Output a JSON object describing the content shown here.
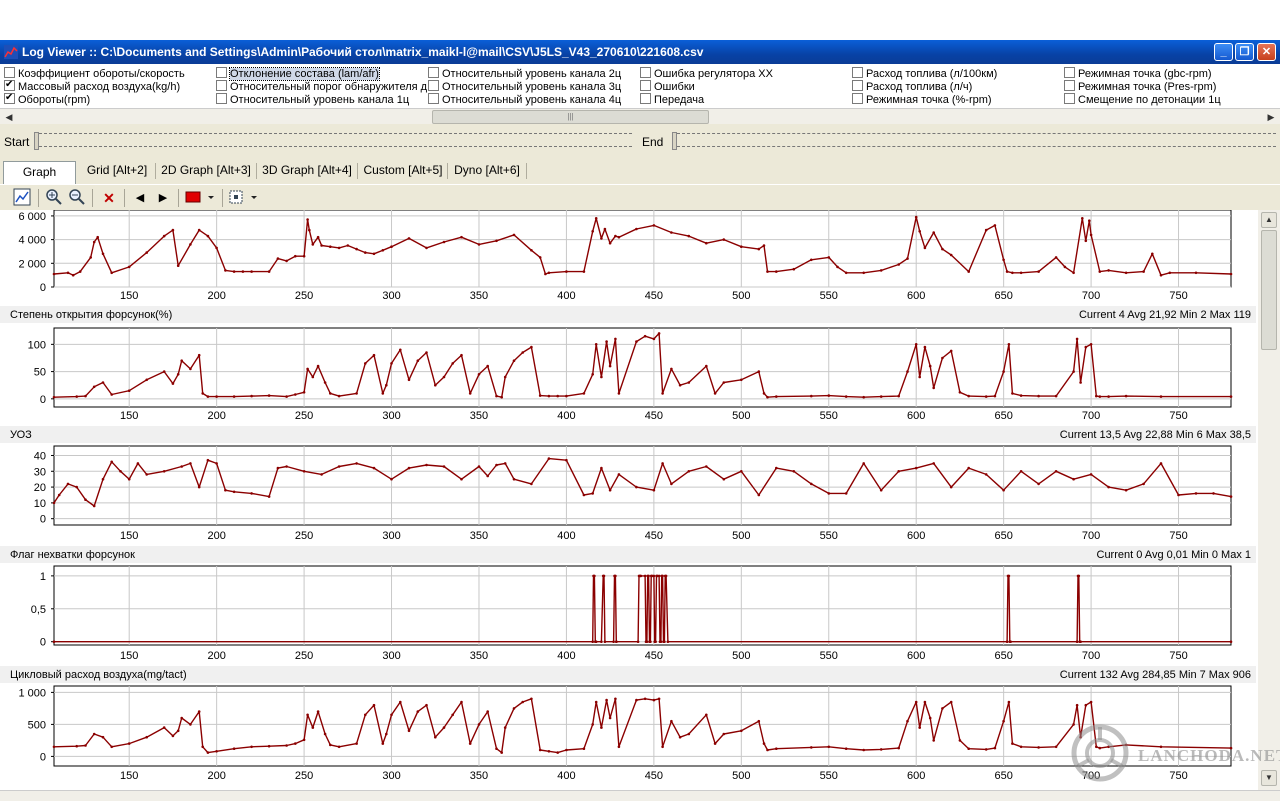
{
  "window": {
    "title": "Log Viewer :: C:\\Documents and Settings\\Admin\\Рабочий стол\\matrix_maikl-l@mail\\CSV\\J5LS_V43_270610\\221608.csv",
    "minimize": "_",
    "maximize": "❐",
    "close": "✕"
  },
  "params": [
    {
      "label": "Коэффициент обороты/скорость",
      "checked": false,
      "selected": false
    },
    {
      "label": "Массовый расход воздуха(kg/h)",
      "checked": true,
      "selected": false
    },
    {
      "label": "Обороты(rpm)",
      "checked": true,
      "selected": false
    },
    {
      "label": "Отклонение состава (lam/afr)",
      "checked": false,
      "selected": true
    },
    {
      "label": "Относительный порог обнаружителя д",
      "checked": false,
      "selected": false
    },
    {
      "label": "Относительный уровень канала 1ц",
      "checked": false,
      "selected": false
    },
    {
      "label": "Относительный уровень канала 2ц",
      "checked": false,
      "selected": false
    },
    {
      "label": "Относительный уровень канала 3ц",
      "checked": false,
      "selected": false
    },
    {
      "label": "Относительный уровень канала 4ц",
      "checked": false,
      "selected": false
    },
    {
      "label": "Ошибка регулятора ХХ",
      "checked": false,
      "selected": false
    },
    {
      "label": "Ошибки",
      "checked": false,
      "selected": false
    },
    {
      "label": "Передача",
      "checked": false,
      "selected": false
    },
    {
      "label": "Расход топлива (л/100км)",
      "checked": false,
      "selected": false
    },
    {
      "label": "Расход топлива (л/ч)",
      "checked": false,
      "selected": false
    },
    {
      "label": "Режимная точка (%-rpm)",
      "checked": false,
      "selected": false
    },
    {
      "label": "Режимная точка (gbc-rpm)",
      "checked": false,
      "selected": false
    },
    {
      "label": "Режимная точка (Pres-rpm)",
      "checked": false,
      "selected": false
    },
    {
      "label": "Смещение по детонации 1ц",
      "checked": false,
      "selected": false
    }
  ],
  "range": {
    "start_label": "Start",
    "end_label": "End"
  },
  "tabs": [
    {
      "label": "Graph [Alt+1]",
      "active": true
    },
    {
      "label": "Grid [Alt+2]",
      "active": false
    },
    {
      "label": "2D Graph [Alt+3]",
      "active": false
    },
    {
      "label": "3D Graph [Alt+4]",
      "active": false
    },
    {
      "label": "Custom [Alt+5]",
      "active": false
    },
    {
      "label": "Dyno [Alt+6]",
      "active": false
    }
  ],
  "toolbar": {
    "icons": [
      "chart-icon",
      "zoom-in-icon",
      "zoom-out-icon",
      "delete-icon",
      "prev-icon",
      "next-icon",
      "color-icon",
      "grid-select-icon"
    ]
  },
  "colors": {
    "series": "#8b0000",
    "grid": "#c8c8c8",
    "header_bg": "#f0f0f0"
  },
  "watermark": "LANCHODA.NET",
  "chart_data": [
    {
      "type": "line",
      "title": "",
      "stats": "",
      "yticks": [
        "6 000",
        "4 000",
        "2 000",
        "0"
      ],
      "ytick_values": [
        6000,
        4000,
        2000,
        0
      ],
      "ylim": [
        0,
        6500
      ],
      "xlim": [
        107,
        780
      ],
      "xticks": [
        150,
        200,
        250,
        300,
        350,
        400,
        450,
        500,
        550,
        600,
        650,
        700,
        750
      ],
      "x": [
        107,
        115,
        118,
        122,
        128,
        130,
        132,
        135,
        140,
        150,
        160,
        170,
        175,
        178,
        185,
        190,
        195,
        200,
        205,
        210,
        215,
        220,
        230,
        235,
        240,
        245,
        250,
        252,
        253,
        255,
        258,
        260,
        265,
        270,
        275,
        280,
        285,
        290,
        295,
        300,
        310,
        320,
        330,
        340,
        350,
        360,
        370,
        380,
        385,
        388,
        390,
        400,
        410,
        415,
        417,
        420,
        422,
        425,
        428,
        430,
        440,
        450,
        460,
        470,
        480,
        490,
        500,
        510,
        513,
        515,
        520,
        530,
        540,
        550,
        555,
        560,
        570,
        580,
        590,
        595,
        600,
        602,
        605,
        610,
        615,
        620,
        630,
        640,
        645,
        650,
        652,
        655,
        660,
        670,
        680,
        685,
        690,
        695,
        697,
        699,
        700,
        705,
        710,
        720,
        730,
        735,
        740,
        745,
        760,
        780
      ],
      "y": [
        1100,
        1200,
        1000,
        1300,
        2500,
        3800,
        4200,
        2800,
        1200,
        1700,
        2900,
        4300,
        4800,
        1800,
        3600,
        4800,
        4300,
        3300,
        1400,
        1300,
        1300,
        1300,
        1300,
        2400,
        2200,
        2600,
        2600,
        5700,
        4800,
        3600,
        4200,
        3500,
        3400,
        3300,
        3500,
        3200,
        2900,
        2800,
        3100,
        3400,
        4100,
        3300,
        3800,
        4200,
        3600,
        3900,
        4400,
        3100,
        2500,
        1100,
        1200,
        1300,
        1300,
        4700,
        5800,
        4100,
        4900,
        3700,
        4300,
        4200,
        4900,
        5200,
        4600,
        4300,
        3700,
        4000,
        3400,
        3200,
        3500,
        1300,
        1300,
        1500,
        2300,
        2500,
        1700,
        1200,
        1200,
        1400,
        1900,
        2400,
        5900,
        4700,
        3300,
        4600,
        3200,
        2700,
        1300,
        4800,
        5200,
        2300,
        1300,
        1200,
        1200,
        1300,
        2500,
        1700,
        1200,
        5800,
        3900,
        5600,
        4400,
        1300,
        1400,
        1200,
        1300,
        2800,
        1000,
        1200,
        1200,
        1100
      ]
    },
    {
      "type": "line",
      "title": "Степень открытия форсунок(%)",
      "stats": "Current 4 Avg 21,92 Min 2 Max 119",
      "yticks": [
        "100",
        "50",
        "0"
      ],
      "ytick_values": [
        100,
        50,
        0
      ],
      "ylim": [
        -15,
        130
      ],
      "xlim": [
        107,
        780
      ],
      "xticks": [
        150,
        200,
        250,
        300,
        350,
        400,
        450,
        500,
        550,
        600,
        650,
        700,
        750
      ],
      "x": [
        107,
        120,
        125,
        130,
        135,
        140,
        150,
        160,
        170,
        175,
        178,
        180,
        185,
        190,
        192,
        195,
        200,
        210,
        220,
        230,
        240,
        245,
        250,
        252,
        255,
        258,
        262,
        265,
        270,
        280,
        285,
        290,
        295,
        297,
        300,
        305,
        310,
        315,
        320,
        325,
        330,
        335,
        340,
        345,
        350,
        355,
        360,
        363,
        365,
        370,
        375,
        380,
        385,
        390,
        395,
        400,
        410,
        415,
        417,
        420,
        423,
        425,
        428,
        430,
        440,
        445,
        450,
        453,
        455,
        460,
        465,
        470,
        480,
        485,
        490,
        500,
        510,
        513,
        515,
        520,
        540,
        550,
        560,
        570,
        580,
        590,
        595,
        600,
        602,
        605,
        608,
        610,
        615,
        620,
        625,
        630,
        640,
        645,
        650,
        653,
        655,
        660,
        670,
        680,
        690,
        692,
        694,
        697,
        700,
        703,
        705,
        710,
        720,
        740,
        780
      ],
      "y": [
        3,
        4,
        5,
        22,
        30,
        8,
        15,
        35,
        50,
        28,
        45,
        70,
        55,
        80,
        10,
        4,
        4,
        4,
        5,
        6,
        4,
        8,
        12,
        55,
        40,
        60,
        30,
        10,
        5,
        10,
        65,
        80,
        10,
        25,
        65,
        90,
        35,
        70,
        85,
        25,
        40,
        65,
        80,
        10,
        45,
        60,
        5,
        3,
        40,
        70,
        85,
        95,
        6,
        5,
        5,
        5,
        10,
        45,
        100,
        40,
        105,
        60,
        110,
        10,
        105,
        115,
        110,
        120,
        10,
        55,
        25,
        30,
        60,
        10,
        30,
        35,
        50,
        10,
        3,
        4,
        5,
        6,
        4,
        3,
        4,
        5,
        50,
        100,
        40,
        95,
        60,
        20,
        75,
        88,
        12,
        5,
        4,
        5,
        50,
        100,
        10,
        6,
        5,
        5,
        50,
        110,
        30,
        95,
        100,
        5,
        4,
        4,
        5,
        4,
        4
      ]
    },
    {
      "type": "line",
      "title": "УОЗ",
      "stats": "Current 13,5 Avg 22,88 Min 6 Max 38,5",
      "yticks": [
        "40",
        "30",
        "20",
        "10",
        "0"
      ],
      "ytick_values": [
        40,
        30,
        20,
        10,
        0
      ],
      "ylim": [
        -4,
        46
      ],
      "xlim": [
        107,
        780
      ],
      "xticks": [
        150,
        200,
        250,
        300,
        350,
        400,
        450,
        500,
        550,
        600,
        650,
        700,
        750
      ],
      "x": [
        107,
        110,
        115,
        120,
        125,
        130,
        135,
        140,
        145,
        150,
        155,
        160,
        170,
        180,
        185,
        190,
        195,
        200,
        205,
        210,
        220,
        230,
        235,
        240,
        250,
        260,
        270,
        280,
        290,
        300,
        310,
        320,
        330,
        340,
        350,
        355,
        360,
        365,
        370,
        380,
        390,
        400,
        410,
        415,
        420,
        425,
        430,
        440,
        450,
        455,
        460,
        470,
        480,
        490,
        500,
        510,
        520,
        530,
        540,
        550,
        560,
        570,
        580,
        590,
        600,
        610,
        620,
        630,
        640,
        650,
        660,
        670,
        680,
        690,
        700,
        710,
        720,
        730,
        740,
        750,
        760,
        770,
        780
      ],
      "y": [
        10,
        15,
        22,
        20,
        12,
        8,
        25,
        36,
        30,
        25,
        35,
        28,
        30,
        33,
        35,
        20,
        37,
        35,
        18,
        17,
        16,
        14,
        32,
        33,
        30,
        28,
        33,
        35,
        32,
        25,
        32,
        34,
        33,
        25,
        33,
        27,
        34,
        35,
        25,
        22,
        38,
        37,
        15,
        16,
        32,
        18,
        28,
        20,
        18,
        35,
        22,
        30,
        33,
        25,
        30,
        15,
        32,
        30,
        22,
        16,
        16,
        35,
        18,
        30,
        32,
        35,
        20,
        32,
        28,
        18,
        30,
        22,
        30,
        25,
        28,
        20,
        18,
        22,
        35,
        15,
        16,
        16,
        14
      ]
    },
    {
      "type": "line",
      "title": "Флаг нехватки форсунок",
      "stats": "Current 0 Avg 0,01 Min 0 Max 1",
      "yticks": [
        "1",
        "0,5",
        "0"
      ],
      "ytick_values": [
        1,
        0.5,
        0
      ],
      "ylim": [
        -0.05,
        1.15
      ],
      "xlim": [
        107,
        780
      ],
      "xticks": [
        150,
        200,
        250,
        300,
        350,
        400,
        450,
        500,
        550,
        600,
        650,
        700,
        750
      ],
      "x": [
        107,
        415,
        415.5,
        416,
        416.5,
        417,
        420,
        421,
        421.5,
        422,
        427,
        427.5,
        428,
        428.5,
        428.6,
        441,
        441.5,
        442,
        442.5,
        445,
        445.5,
        446,
        446.5,
        447,
        447.5,
        448,
        448.5,
        449,
        450,
        450.5,
        451,
        451.5,
        452,
        453,
        453.5,
        454,
        454.5,
        455,
        455.5,
        456,
        456.5,
        457,
        458,
        652,
        652.5,
        653,
        653.5,
        654,
        692,
        692.5,
        693,
        693.5,
        694,
        780
      ],
      "y": [
        0,
        0,
        1,
        1,
        0,
        0,
        0,
        1,
        1,
        0,
        0,
        1,
        1,
        0,
        0,
        0,
        1,
        1,
        1,
        1,
        0,
        0,
        1,
        1,
        0,
        0,
        1,
        1,
        1,
        0,
        0,
        1,
        1,
        1,
        0,
        0,
        1,
        1,
        0,
        0,
        1,
        1,
        0,
        0,
        1,
        1,
        0,
        0,
        0,
        1,
        1,
        0,
        0,
        0
      ]
    },
    {
      "type": "line",
      "title": "Цикловый расход воздуха(mg/tact)",
      "stats": "Current 132 Avg 284,85 Min 7 Max 906",
      "yticks": [
        "1 000",
        "500",
        "0"
      ],
      "ytick_values": [
        1000,
        500,
        0
      ],
      "ylim": [
        -150,
        1100
      ],
      "xlim": [
        107,
        780
      ],
      "xticks": [
        150,
        200,
        250,
        300,
        350,
        400,
        450,
        500,
        550,
        600,
        650,
        700,
        750
      ],
      "x": [
        107,
        120,
        125,
        130,
        135,
        140,
        150,
        160,
        170,
        175,
        178,
        180,
        185,
        190,
        192,
        195,
        200,
        210,
        220,
        230,
        240,
        245,
        250,
        252,
        255,
        258,
        262,
        265,
        270,
        280,
        285,
        290,
        295,
        297,
        300,
        305,
        310,
        315,
        320,
        325,
        330,
        335,
        340,
        345,
        350,
        355,
        360,
        363,
        365,
        370,
        375,
        380,
        385,
        390,
        395,
        400,
        410,
        415,
        417,
        420,
        423,
        425,
        428,
        430,
        440,
        445,
        450,
        453,
        455,
        460,
        465,
        470,
        480,
        485,
        490,
        500,
        510,
        513,
        515,
        520,
        540,
        550,
        560,
        570,
        580,
        590,
        595,
        600,
        602,
        605,
        608,
        610,
        615,
        620,
        625,
        630,
        640,
        645,
        650,
        653,
        655,
        660,
        670,
        680,
        690,
        692,
        694,
        697,
        700,
        703,
        705,
        710,
        720,
        740,
        780
      ],
      "y": [
        150,
        160,
        170,
        350,
        300,
        150,
        200,
        300,
        450,
        320,
        400,
        600,
        500,
        700,
        150,
        60,
        80,
        120,
        150,
        160,
        170,
        200,
        260,
        650,
        450,
        700,
        350,
        180,
        150,
        200,
        650,
        800,
        200,
        350,
        650,
        850,
        400,
        700,
        800,
        300,
        450,
        650,
        850,
        200,
        500,
        700,
        120,
        60,
        450,
        750,
        850,
        900,
        100,
        80,
        60,
        100,
        120,
        500,
        850,
        450,
        880,
        600,
        900,
        150,
        880,
        900,
        880,
        900,
        150,
        550,
        300,
        350,
        650,
        200,
        350,
        400,
        550,
        200,
        100,
        120,
        140,
        150,
        120,
        100,
        110,
        130,
        550,
        850,
        450,
        850,
        600,
        250,
        750,
        850,
        250,
        120,
        110,
        130,
        550,
        850,
        200,
        150,
        140,
        150,
        500,
        800,
        300,
        800,
        850,
        150,
        130,
        150,
        180,
        150,
        130
      ]
    }
  ]
}
